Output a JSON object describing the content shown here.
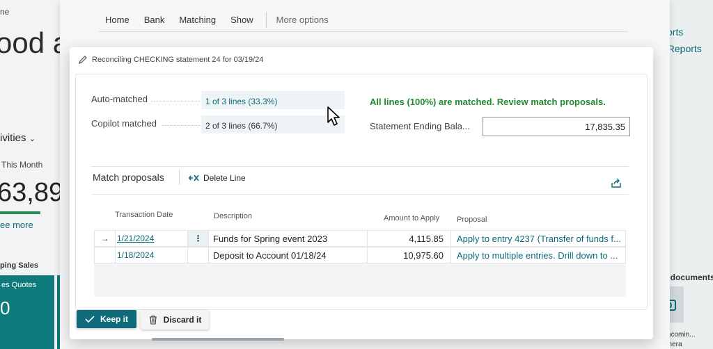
{
  "background": {
    "home": "ne",
    "big_text": "ood a",
    "activities": "ivities",
    "this_month": "This Month",
    "kpi_value": "63,89",
    "see_more": "ee more",
    "section_sales": "ping Sales",
    "tile_label": "es Quotes",
    "tile_glyph": "0",
    "reports_1": "orts",
    "reports_2": "el Reports",
    "docs_title": "n documents",
    "incoming": "te Incomin...",
    "camera": "Camera"
  },
  "top_nav": {
    "items": [
      "Home",
      "Bank",
      "Matching",
      "Show"
    ],
    "more": "More options"
  },
  "dialog": {
    "title": "Reconciling CHECKING statement 24 for 03/19/24",
    "auto_matched_label": "Auto-matched",
    "auto_matched_value": "1 of 3 lines (33.3%)",
    "copilot_matched_label": "Copilot matched",
    "copilot_matched_value": "2 of 3 lines (66.7%)",
    "success_message": "All lines (100%) are matched. Review match proposals.",
    "balance_label": "Statement Ending Bala...",
    "balance_value": "17,835.35",
    "match_proposals_title": "Match proposals",
    "delete_line": "Delete Line",
    "columns": {
      "transaction_date": "Transaction Date",
      "description": "Description",
      "amount": "Amount to Apply",
      "proposal": "Proposal"
    },
    "rows": [
      {
        "date": "1/21/2024",
        "description": "Funds for Spring event 2023",
        "amount": "4,115.85",
        "proposal": "Apply to entry 4237 (Transfer of funds f..."
      },
      {
        "date": "1/18/2024",
        "description": "Deposit to Account 01/18/24",
        "amount": "10,975.60",
        "proposal": "Apply to multiple entries. Drill down to ..."
      }
    ],
    "row_arrow": "→",
    "kebab": "⋮"
  },
  "actions": {
    "keep": "Keep it",
    "discard": "Discard it"
  },
  "colors": {
    "accent": "#0f6b7a",
    "success": "#1f8a2e",
    "link": "#0b6a78"
  }
}
